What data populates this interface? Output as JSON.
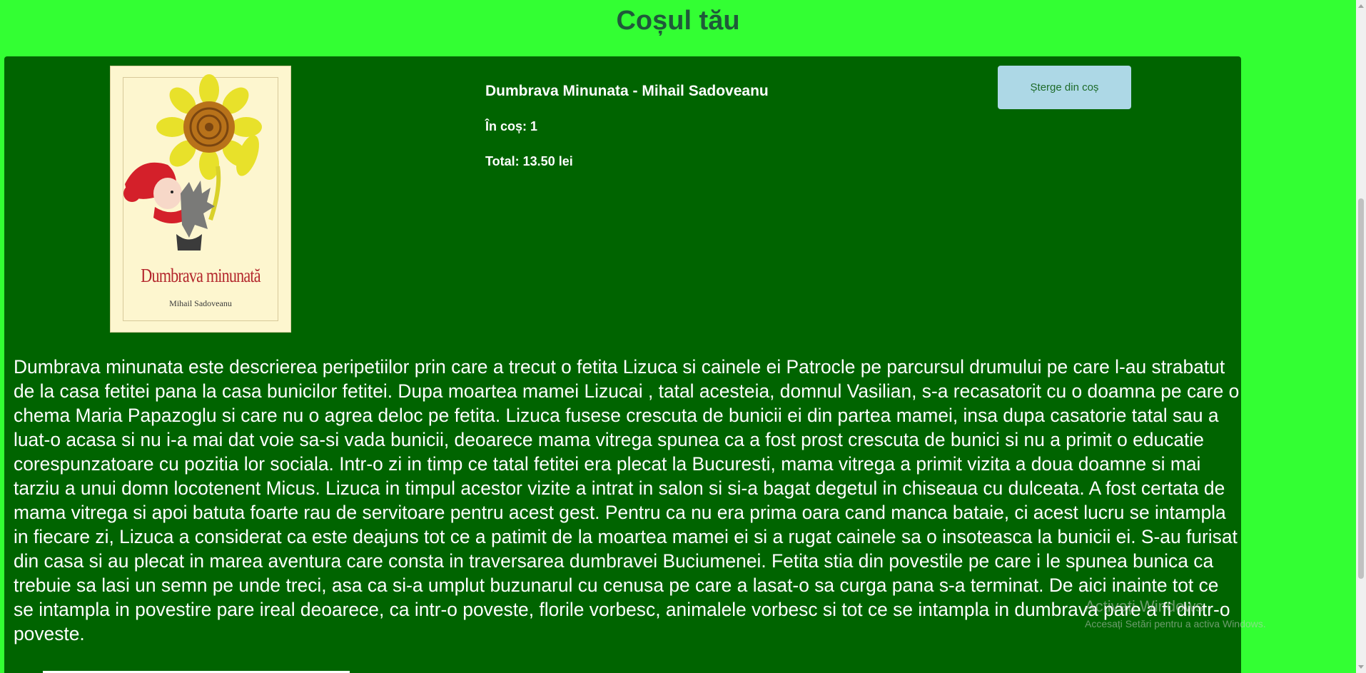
{
  "page": {
    "title": "Coșul tău"
  },
  "cart_item": {
    "cover": {
      "title": "Dumbrava minunată",
      "author": "Mihail Sadoveanu"
    },
    "product_name": "Dumbrava Minunata - Mihail Sadoveanu",
    "quantity_text": "În coș: 1",
    "total_text": "Total: 13.50 lei",
    "remove_label": "Șterge din coș",
    "description": "Dumbrava minunata este descrierea peripetiilor prin care a trecut o fetita Lizuca si cainele ei Patrocle pe parcursul drumului pe care l-au strabatut de la casa fetitei pana la casa bunicilor fetitei. Dupa moartea mamei Lizucai , tatal acesteia, domnul Vasilian, s-a recasatorit cu o doamna pe care o chema Maria Papazoglu si care nu o agrea deloc pe fetita. Lizuca fusese crescuta de bunicii ei din partea mamei, insa dupa casatorie tatal sau a luat-o acasa si nu i-a mai dat voie sa-si vada bunicii, deoarece mama vitrega spunea ca a fost prost crescuta de bunici si nu a primit o educatie corespunzatoare cu pozitia lor sociala. Intr-o zi in timp ce tatal fetitei era plecat la Bucuresti, mama vitrega a primit vizita a doua doamne si mai tarziu a unui domn locotenent Micus. Lizuca in timpul acestor vizite a intrat in salon si si-a bagat degetul in chiseaua cu dulceata. A fost certata de mama vitrega si apoi batuta foarte rau de servitoare pentru acest gest. Pentru ca nu era prima oara cand manca bataie, ci acest lucru se intampla in fiecare zi, Lizuca a considerat ca este deajuns tot ce a patimit de la moartea mamei ei si a rugat cainele sa o insoteasca la bunicii ei. S-au furisat din casa si au plecat in marea aventura care consta in traversarea dumbravei Buciumenei. Fetita stia din povestile pe care i le spunea bunica ca trebuie sa lasi un semn pe unde treci, asa ca si-a umplut buzunarul cu cenusa pe care a lasat-o sa curga pana s-a terminat. De aici inainte tot ce se intampla in povestire pare ireal deoarece, ca intr-o poveste, florile vorbesc, animalele vorbesc si tot ce se intampla in dumbrava pare a fi dintr-o poveste."
  },
  "watermark": {
    "line1": "Activați Windows",
    "line2": "Accesați Setări pentru a activa Windows."
  },
  "colors": {
    "page_background": "#33ff33",
    "card_background": "#006400",
    "title_color": "#1f5a3a",
    "button_background": "#add8e6"
  }
}
